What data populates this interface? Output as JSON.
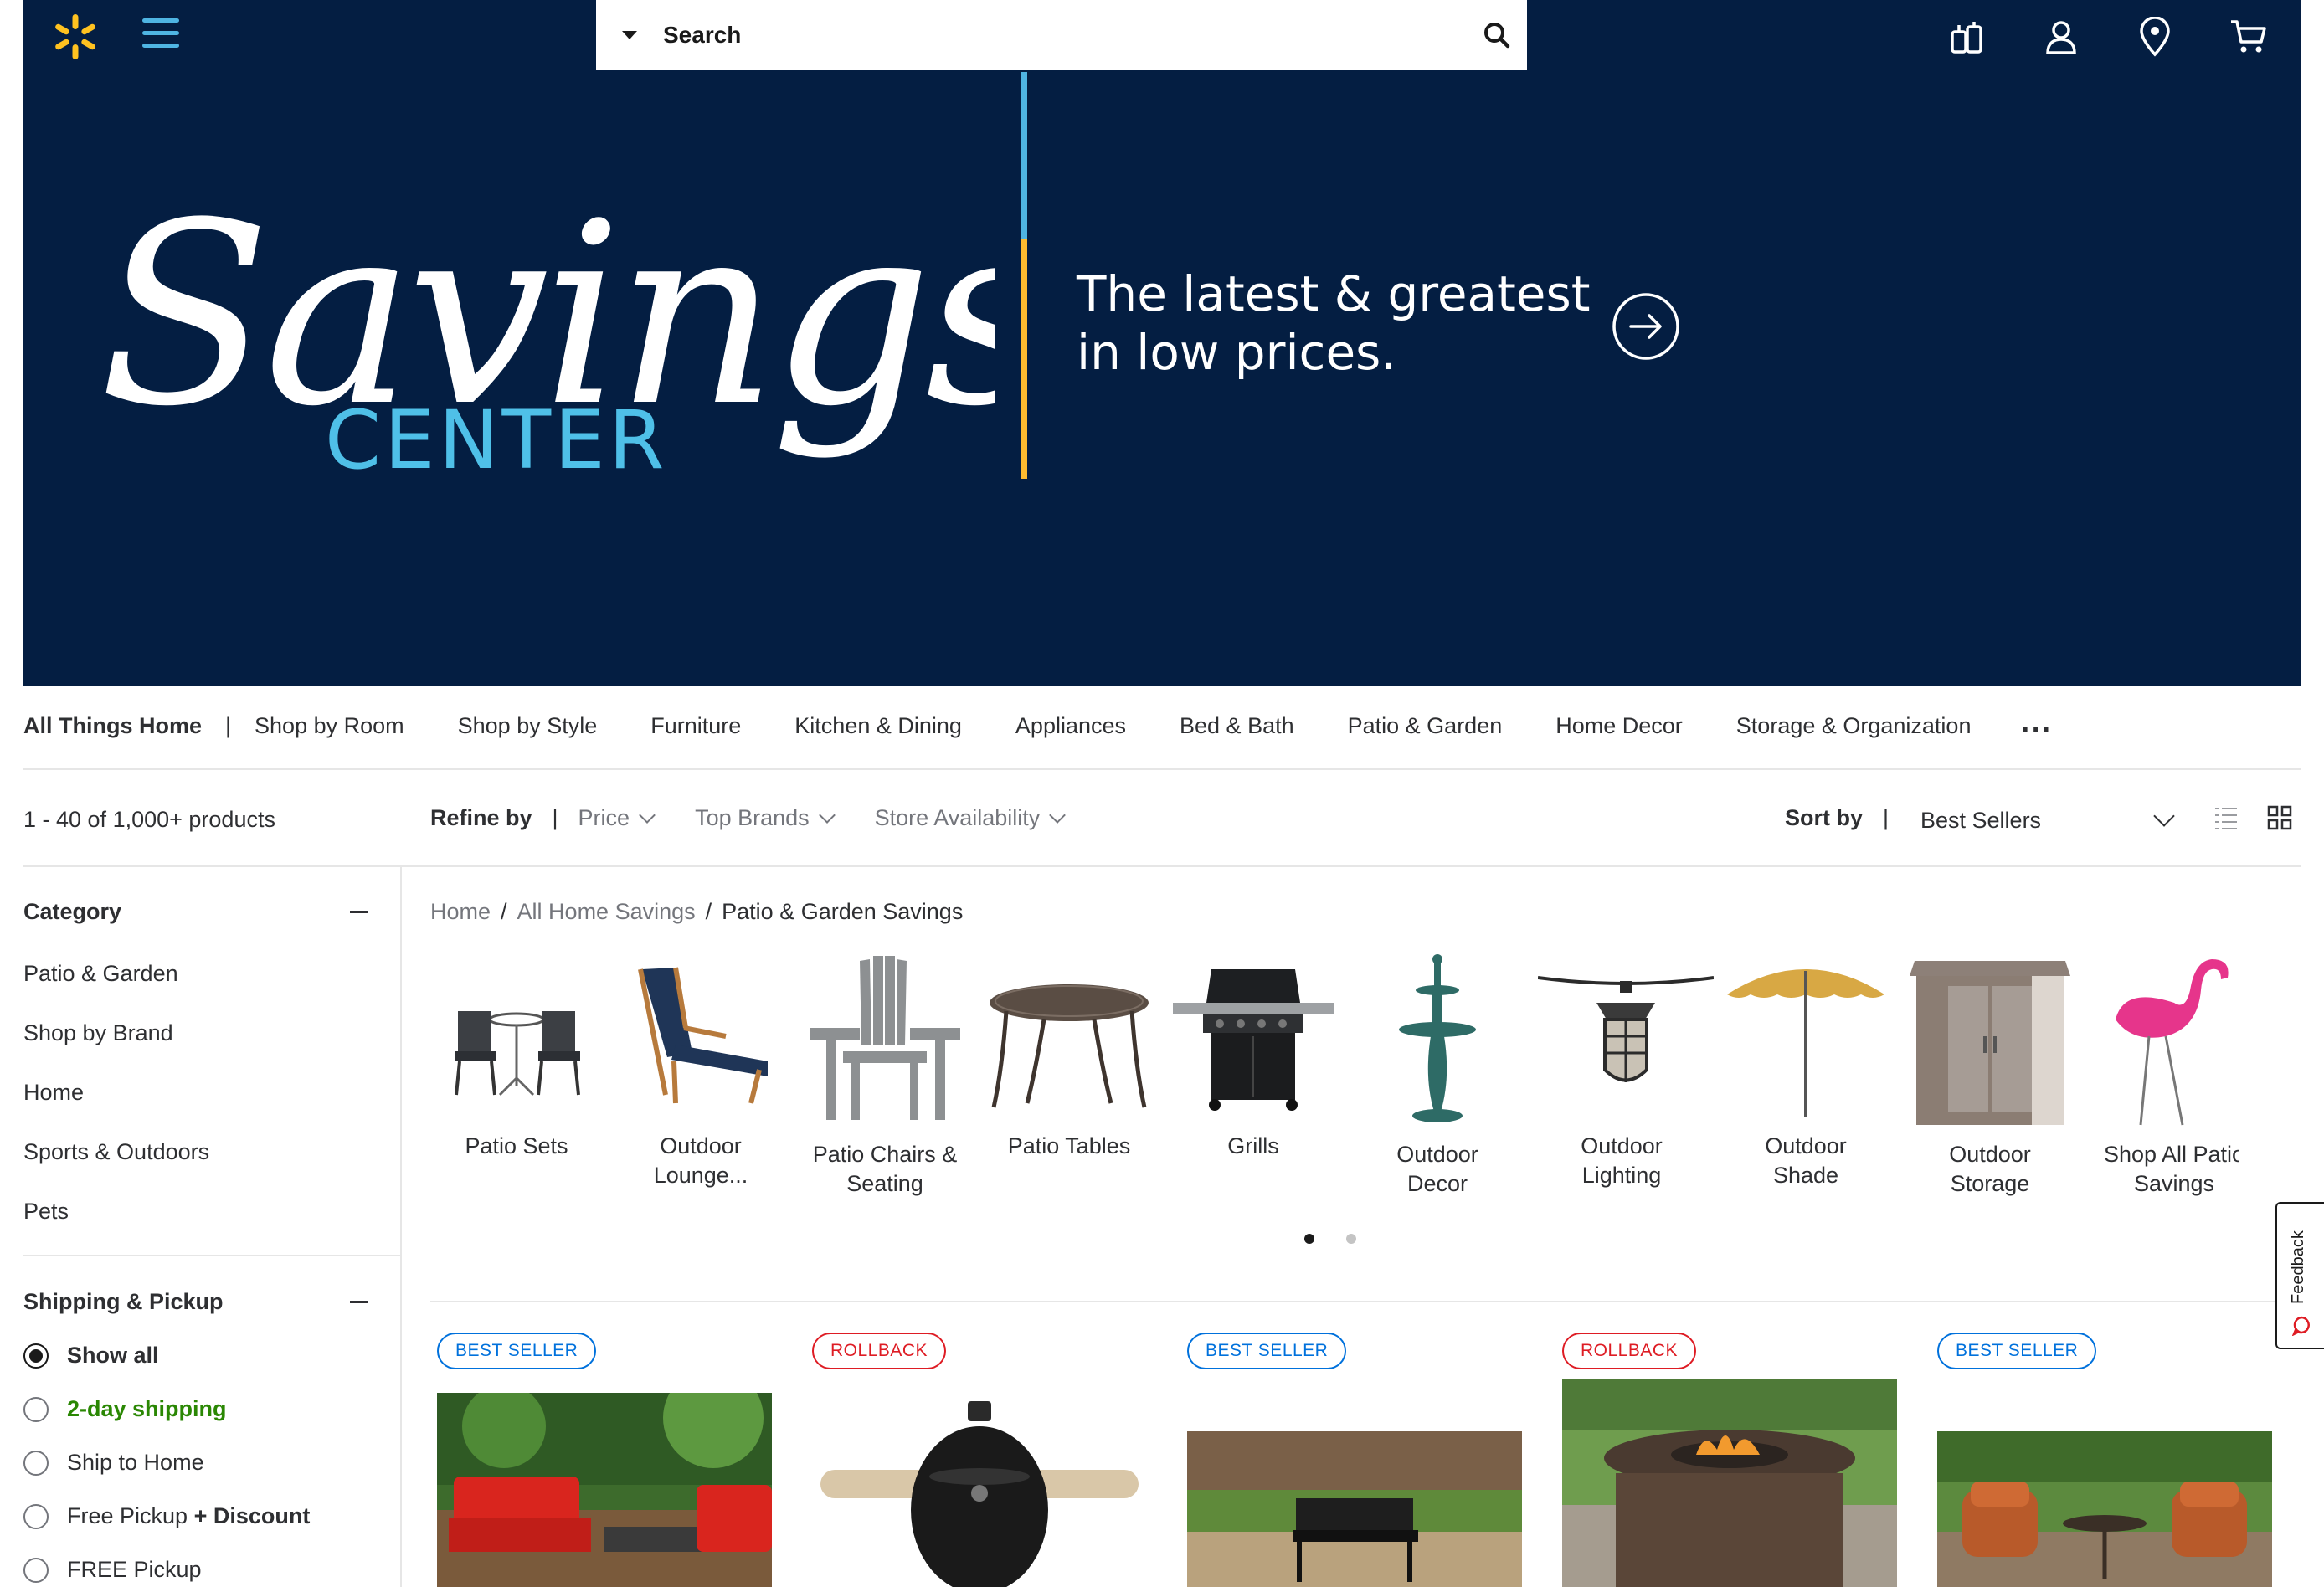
{
  "header": {
    "logo_icon": "walmart-spark-icon",
    "menu_icon": "hamburger-menu-icon",
    "search": {
      "placeholder": "Search",
      "dept_icon": "caret-down-icon",
      "button_icon": "search-icon"
    },
    "icons": [
      "reorder-icon",
      "account-icon",
      "location-pin-icon",
      "cart-icon"
    ]
  },
  "hero": {
    "script_title": "Savings",
    "subtitle": "CENTER",
    "tagline_line1": "The latest & greatest",
    "tagline_line2": "in low prices.",
    "arrow_icon": "arrow-right-circle-icon",
    "colors": {
      "background": "#041e42",
      "accent_blue": "#4fb5e3",
      "accent_yellow": "#fdbb30"
    }
  },
  "cat_nav": {
    "root": "All Things Home",
    "separator": "|",
    "items": [
      "Shop by Room",
      "Shop by Style",
      "Furniture",
      "Kitchen & Dining",
      "Appliances",
      "Bed & Bath",
      "Patio & Garden",
      "Home Decor",
      "Storage & Organization"
    ],
    "more": "..."
  },
  "refine_bar": {
    "count": "1 - 40 of 1,000+ products",
    "refine_label": "Refine by",
    "separator": "|",
    "filters": [
      "Price",
      "Top Brands",
      "Store Availability"
    ],
    "sort_label": "Sort by",
    "sort_value": "Best Sellers",
    "view_icons": [
      "list-view-icon",
      "grid-view-icon"
    ]
  },
  "sidebar": {
    "category": {
      "title": "Category",
      "items": [
        "Patio & Garden",
        "Shop by Brand",
        "Home",
        "Sports & Outdoors",
        "Pets"
      ]
    },
    "shipping": {
      "title": "Shipping & Pickup",
      "options": [
        {
          "label": "Show all",
          "selected": true
        },
        {
          "label": "2-day shipping",
          "selected": false
        },
        {
          "label": "Ship to Home",
          "selected": false
        },
        {
          "label": "Free Pickup",
          "suffix": "+ Discount",
          "selected": false
        },
        {
          "label": "FREE Pickup",
          "selected": false
        }
      ]
    }
  },
  "breadcrumb": {
    "items": [
      "Home",
      "All Home Savings"
    ],
    "current": "Patio & Garden Savings",
    "separator": "/"
  },
  "carousel": {
    "tiles": [
      {
        "line1": "Patio Sets",
        "line2": ""
      },
      {
        "line1": "Outdoor",
        "line2": "Lounge..."
      },
      {
        "line1": "Patio Chairs &",
        "line2": "Seating"
      },
      {
        "line1": "Patio Tables",
        "line2": ""
      },
      {
        "line1": "Grills",
        "line2": ""
      },
      {
        "line1": "Outdoor",
        "line2": "Decor"
      },
      {
        "line1": "Outdoor",
        "line2": "Lighting"
      },
      {
        "line1": "Outdoor",
        "line2": "Shade"
      },
      {
        "line1": "Outdoor",
        "line2": "Storage"
      },
      {
        "line1": "Shop All Patio",
        "line2": "Savings"
      }
    ],
    "page": 1,
    "pages": 2
  },
  "products": [
    {
      "badge": "BEST SELLER",
      "badge_type": "best"
    },
    {
      "badge": "ROLLBACK",
      "badge_type": "rollback"
    },
    {
      "badge": "BEST SELLER",
      "badge_type": "best"
    },
    {
      "badge": "ROLLBACK",
      "badge_type": "rollback"
    },
    {
      "badge": "BEST SELLER",
      "badge_type": "best"
    }
  ],
  "feedback": {
    "label": "Feedback",
    "icon": "chat-bubble-icon"
  }
}
